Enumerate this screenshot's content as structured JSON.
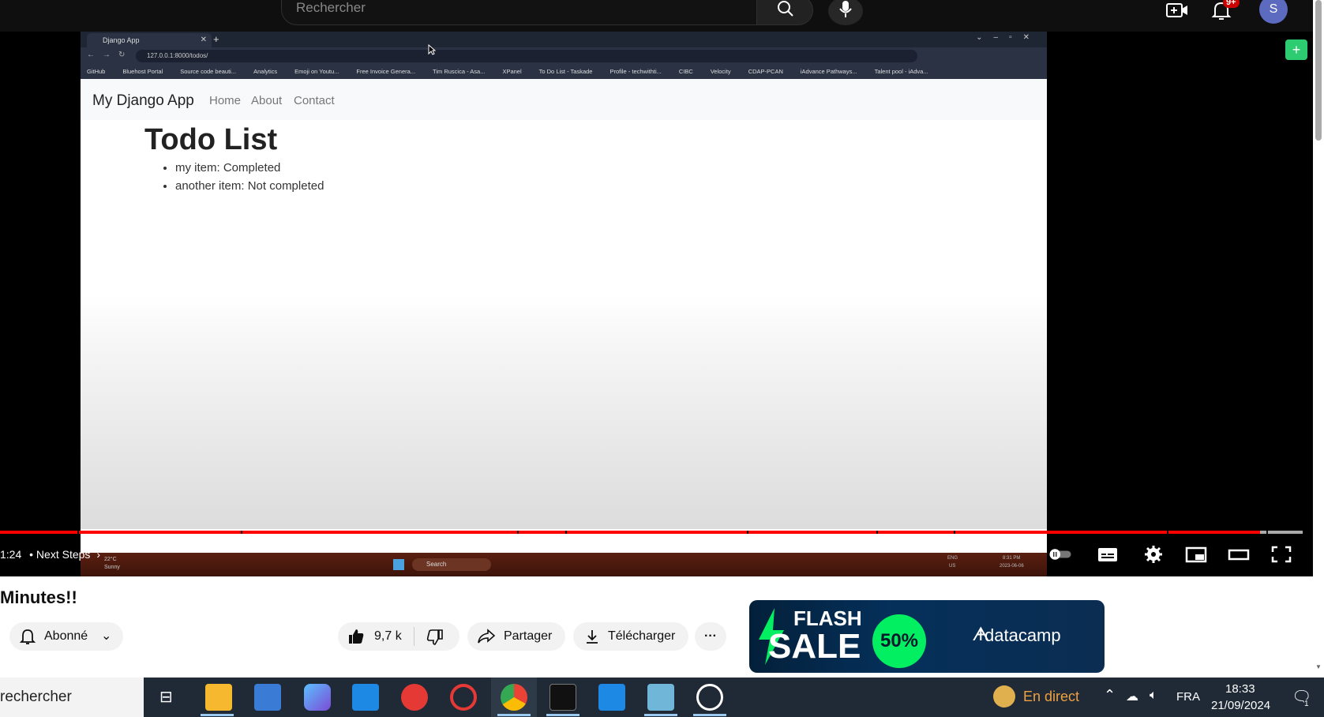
{
  "youtube_header": {
    "search_placeholder": "Rechercher",
    "notification_count": "9+",
    "avatar_letter": "S"
  },
  "browser": {
    "tab_title": "Django App",
    "url": "127.0.0.1:8000/todos/",
    "bookmarks": [
      "GitHub",
      "Bluehost Portal",
      "Source code beauti...",
      "Analytics",
      "Emoji on Youtu...",
      "Free Invoice Genera...",
      "Tim Ruscica - Asa...",
      "XPanel",
      "To Do List - Taskade",
      "Profile - techwithti...",
      "CIBC",
      "Velocity",
      "CDAP-PCAN",
      "iAdvance Pathways...",
      "Talent pool - iAdva..."
    ]
  },
  "django_page": {
    "brand": "My Django App",
    "nav": [
      "Home",
      "About",
      "Contact"
    ],
    "heading": "Todo List",
    "items": [
      "my item: Completed",
      "another item: Not completed"
    ]
  },
  "inner_taskbar": {
    "weather_temp": "22°C",
    "weather_desc": "Sunny",
    "search": "Search",
    "lang_top": "ENG",
    "lang_bottom": "US",
    "clock_time": "8:31 PM",
    "clock_date": "2023-06-06"
  },
  "player": {
    "time": "1:24",
    "chapter": "• Next Steps",
    "progress_percent": 96.7
  },
  "video_info": {
    "title": "Minutes!!",
    "subscribe_label": "Abonné",
    "likes": "9,7 k",
    "share_label": "Partager",
    "download_label": "Télécharger"
  },
  "ad": {
    "flash": "FLASH",
    "sale": "SALE",
    "discount": "50%",
    "brand": "datacamp"
  },
  "taskbar": {
    "search": "rechercher",
    "live_label": "En direct",
    "lang": "FRA",
    "time": "18:33",
    "date": "21/09/2024",
    "notif_count": "1"
  }
}
